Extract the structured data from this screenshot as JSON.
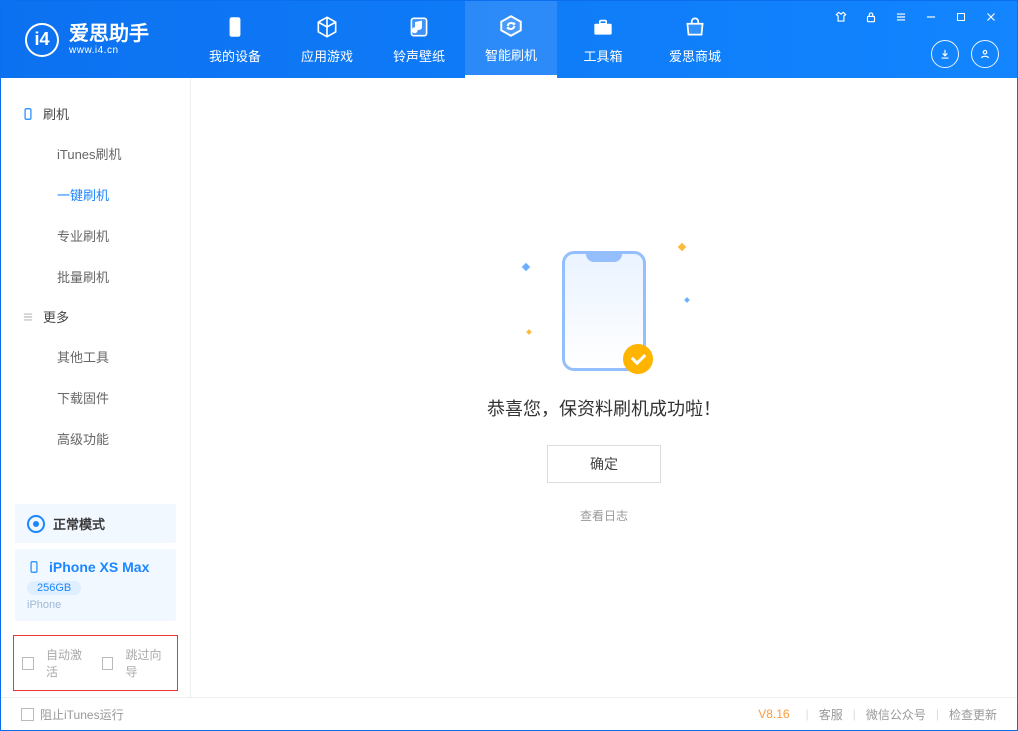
{
  "brand": {
    "name": "爱思助手",
    "url": "www.i4.cn"
  },
  "tabs": [
    {
      "label": "我的设备"
    },
    {
      "label": "应用游戏"
    },
    {
      "label": "铃声壁纸"
    },
    {
      "label": "智能刷机"
    },
    {
      "label": "工具箱"
    },
    {
      "label": "爱思商城"
    }
  ],
  "sidebar": {
    "group_flash": "刷机",
    "items_flash": [
      {
        "label": "iTunes刷机"
      },
      {
        "label": "一键刷机"
      },
      {
        "label": "专业刷机"
      },
      {
        "label": "批量刷机"
      }
    ],
    "group_more": "更多",
    "items_more": [
      {
        "label": "其他工具"
      },
      {
        "label": "下载固件"
      },
      {
        "label": "高级功能"
      }
    ]
  },
  "status": {
    "mode": "正常模式"
  },
  "device": {
    "name": "iPhone XS Max",
    "capacity": "256GB",
    "model": "iPhone"
  },
  "options": {
    "auto_activate": "自动激活",
    "skip_guide": "跳过向导"
  },
  "main": {
    "success_text": "恭喜您，保资料刷机成功啦！",
    "confirm": "确定",
    "view_log": "查看日志"
  },
  "footer": {
    "block_itunes": "阻止iTunes运行",
    "version": "V8.16",
    "service": "客服",
    "wechat": "微信公众号",
    "check_update": "检查更新"
  }
}
